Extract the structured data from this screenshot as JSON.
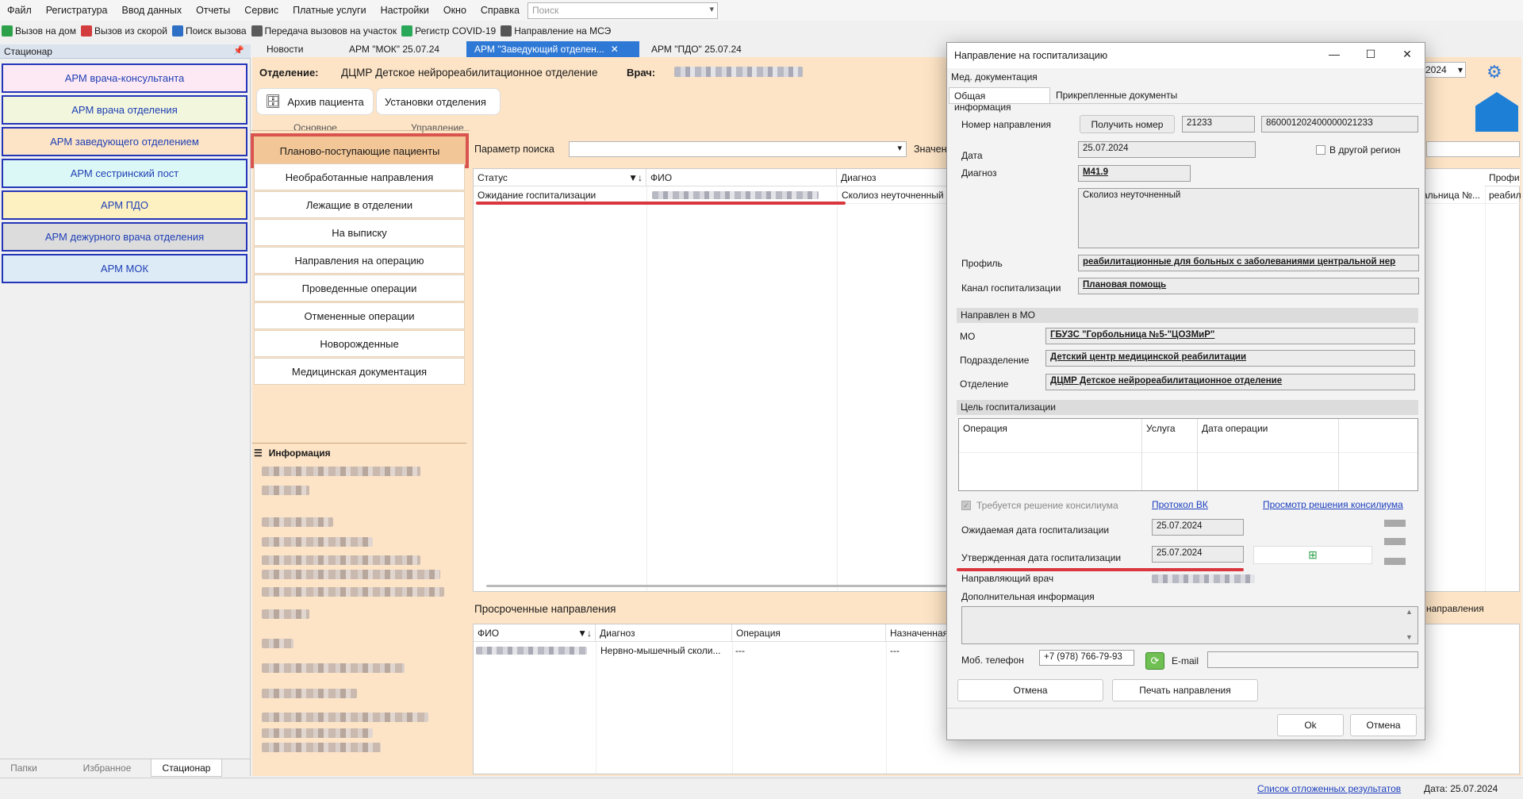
{
  "menu": [
    "Файл",
    "Регистратура",
    "Ввод данных",
    "Отчеты",
    "Сервис",
    "Платные услуги",
    "Настройки",
    "Окно",
    "Справка"
  ],
  "search": {
    "placeholder": "Поиск"
  },
  "toolbar": [
    {
      "label": "Вызов на дом",
      "icon": "house-check-icon",
      "color": "#2ca14a"
    },
    {
      "label": "Вызов из скорой",
      "icon": "ambulance-icon",
      "color": "#d33c3c"
    },
    {
      "label": "Поиск вызова",
      "icon": "magnifier-icon",
      "color": "#2d6fc5"
    },
    {
      "label": "Передача вызовов на участок",
      "icon": "phone-transfer-icon",
      "color": "#5a5a5a"
    },
    {
      "label": "Регистр COVID-19",
      "icon": "virus-icon",
      "color": "#2aa85a"
    },
    {
      "label": "Направление на МСЭ",
      "icon": "document-icon",
      "color": "#555"
    }
  ],
  "left_panel": {
    "title": "Стационар",
    "arms": [
      {
        "label": "АРМ врача-консультанта",
        "bg": "#fde9f3"
      },
      {
        "label": "АРМ врача отделения",
        "bg": "#f1f6dc"
      },
      {
        "label": "АРМ заведующего отделением",
        "bg": "#fde4c6"
      },
      {
        "label": "АРМ сестринский пост",
        "bg": "#dcf8f6"
      },
      {
        "label": "АРМ ПДО",
        "bg": "#fdf1c2"
      },
      {
        "label": "АРМ дежурного врача отделения",
        "bg": "#dcdcdc"
      },
      {
        "label": "АРМ МОК",
        "bg": "#dcebf6"
      }
    ],
    "bottom_tabs": [
      "Папки",
      "Избранное",
      "Стационар"
    ]
  },
  "tabs": [
    "Новости",
    "АРМ \"МОК\" 25.07.24",
    "АРМ \"Заведующий отделен...",
    "АРМ \"ПДО\" 25.07.24"
  ],
  "header": {
    "dept_label": "Отделение:",
    "dept_value": "ДЦМР Детское нейрореабилитационное отделение",
    "doctor_label": "Врач:"
  },
  "buttons": {
    "archive": "Архив пациента",
    "settings": "Установки отделения",
    "group_main": "Основное",
    "group_manage": "Управление"
  },
  "nav": [
    "Планово-поступающие пациенты",
    "Необработанные направления",
    "Лежащие в отделении",
    "На выписку",
    "Направления на операцию",
    "Проведенные операции",
    "Отмененные операции",
    "Новорожденные",
    "Медицинская документация"
  ],
  "info": {
    "title": "Информация"
  },
  "params": {
    "label": "Параметр поиска",
    "right_label": "Значен"
  },
  "grid1": {
    "columns": [
      "Статус",
      "ФИО",
      "Диагноз"
    ],
    "right_cols": [
      "Профи",
      "альница №...",
      "реабил"
    ],
    "row": {
      "status": "Ожидание госпитализации",
      "diagnosis": "Сколиоз неуточненный"
    }
  },
  "overdue": {
    "label": "Просроченные направления",
    "columns": [
      "ФИО",
      "Диагноз",
      "Операция",
      "Назначенная"
    ],
    "right_col": "направления",
    "row": {
      "diagnosis": "Нервно-мышечный сколи...",
      "op": "---",
      "assigned": "---"
    }
  },
  "status_bar": {
    "link": "Список отложенных результатов",
    "date": "Дата: 25.07.2024"
  },
  "right_top": {
    "year": "2024"
  },
  "dialog": {
    "title": "Направление на госпитализацию",
    "subtitle": "Мед. документация",
    "tabs": [
      "Общая информация",
      "Прикрепленные документы"
    ],
    "number_label": "Номер направления",
    "get_number": "Получить номер",
    "number1": "21233",
    "number2": "86000120240000002123З",
    "date_label": "Дата",
    "date": "25.07.2024",
    "other_region": "В другой регион",
    "diag_label": "Диагноз",
    "diag_code": "M41.9",
    "diag_text": "Сколиоз неуточненный",
    "profile_label": "Профиль",
    "profile": "реабилитационные для больных с заболеваниями центральной нер",
    "channel_label": "Канал госпитализации",
    "channel": "Плановая помощь",
    "mo_section": "Направлен в МО",
    "mo_label": "МО",
    "mo": "ГБУЗС \"Горбольница №5-\"ЦОЗМиР\"",
    "sub_label": "Подразделение",
    "sub": "Детский центр медицинской реабилитации",
    "dept_label": "Отделение",
    "dept": "ДЦМР Детское нейрореабилитационное отделение",
    "goal_section": "Цель госпитализации",
    "goal_cols": [
      "Операция",
      "Услуга",
      "Дата операции"
    ],
    "consilium": "Требуется решение консилиума",
    "protocol": "Протокол ВК",
    "view_consilium": "Просмотр решения консилиума",
    "expected_label": "Ожидаемая дата госпитализации",
    "expected": "25.07.2024",
    "approved_label": "Утвержденная дата госпитализации",
    "approved": "25.07.2024",
    "ref_doctor": "Направляющий врач",
    "extra_label": "Дополнительная информация",
    "phone_label": "Моб. телефон",
    "phone": "+7 (978) 766-79-93",
    "email_label": "E-mail",
    "cancel_inner": "Отмена",
    "print": "Печать направления",
    "ok": "Ok",
    "cancel": "Отмена"
  }
}
